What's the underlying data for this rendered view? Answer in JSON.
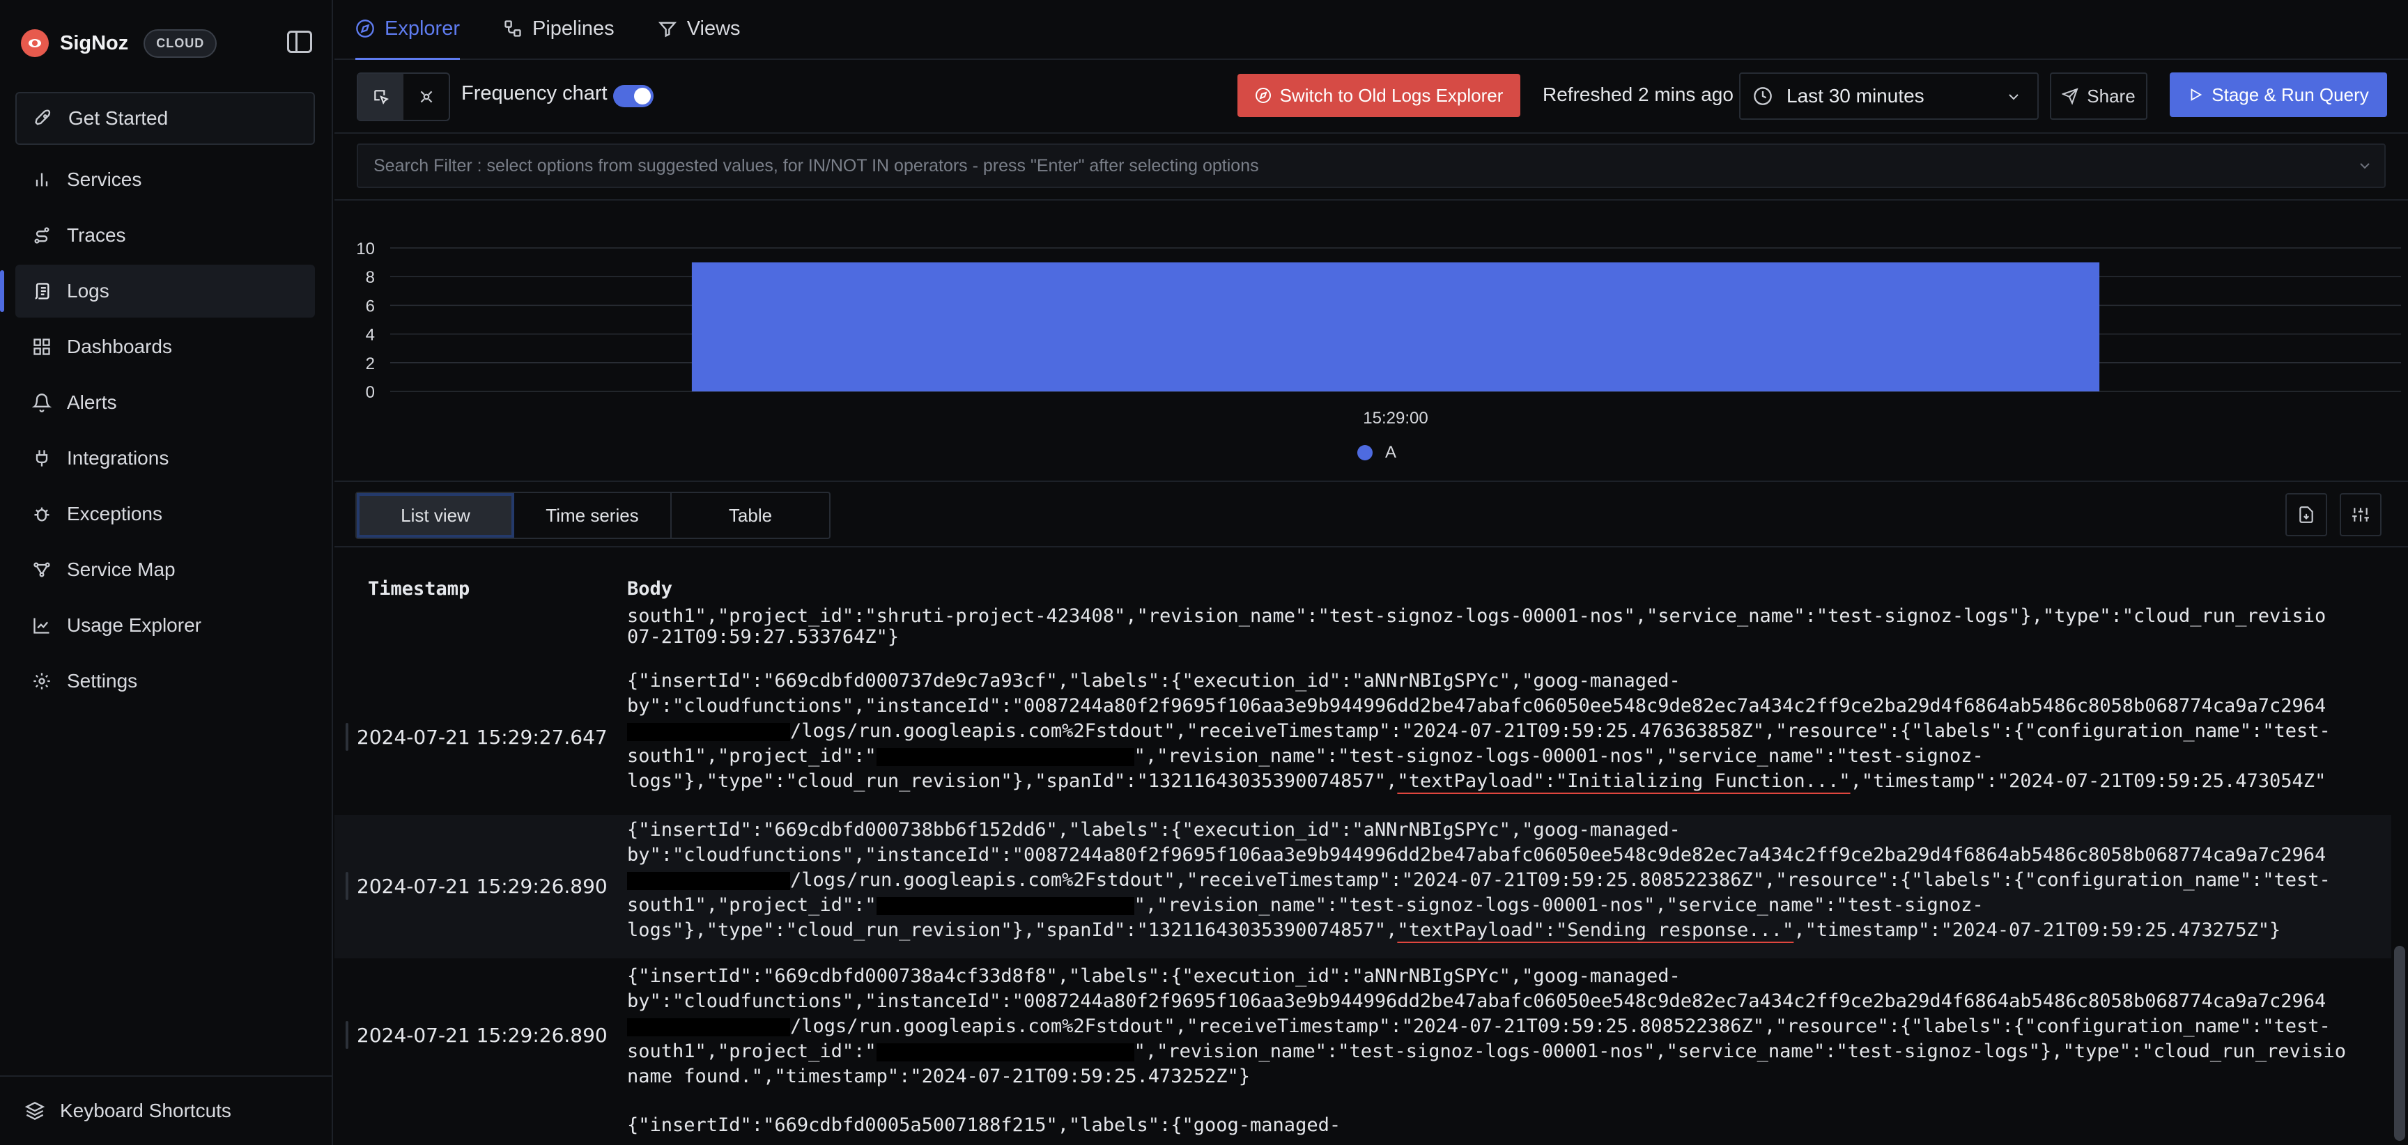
{
  "app": {
    "name": "SigNoz",
    "badge": "CLOUD"
  },
  "sidebar": {
    "items": [
      {
        "label": "Get Started",
        "icon": "rocket-icon"
      },
      {
        "label": "Services",
        "icon": "bar-chart-icon"
      },
      {
        "label": "Traces",
        "icon": "route-icon"
      },
      {
        "label": "Logs",
        "icon": "scroll-icon"
      },
      {
        "label": "Dashboards",
        "icon": "layout-grid-icon"
      },
      {
        "label": "Alerts",
        "icon": "bell-icon"
      },
      {
        "label": "Integrations",
        "icon": "plug-icon"
      },
      {
        "label": "Exceptions",
        "icon": "bug-icon"
      },
      {
        "label": "Service Map",
        "icon": "map-icon"
      },
      {
        "label": "Usage Explorer",
        "icon": "line-chart-icon"
      },
      {
        "label": "Settings",
        "icon": "gear-icon"
      }
    ],
    "active": "Logs",
    "shortcuts_label": "Keyboard Shortcuts"
  },
  "tabs": [
    {
      "label": "Explorer",
      "icon": "compass-icon",
      "active": true
    },
    {
      "label": "Pipelines",
      "icon": "workflow-icon",
      "active": false
    },
    {
      "label": "Views",
      "icon": "views-icon",
      "active": false
    }
  ],
  "toolbar": {
    "frequency_label": "Frequency chart",
    "frequency_on": true,
    "old_explorer_label": "Switch to Old Logs Explorer",
    "refreshed_label": "Refreshed 2 mins ago",
    "time_range": "Last 30 minutes",
    "share_label": "Share",
    "run_label": "Stage & Run Query"
  },
  "search": {
    "placeholder": "Search Filter : select options from suggested values, for IN/NOT IN operators - press \"Enter\" after selecting options"
  },
  "chart_data": {
    "type": "bar",
    "categories": [
      "15:29:00"
    ],
    "series": [
      {
        "name": "A",
        "values": [
          9
        ]
      }
    ],
    "ylim": [
      0,
      10
    ],
    "yticks": [
      0,
      2,
      4,
      6,
      8,
      10
    ],
    "grid": true,
    "legend": "bottom-center",
    "color": "#4e6be0"
  },
  "view_tabs": [
    {
      "label": "List view",
      "active": true
    },
    {
      "label": "Time series",
      "active": false
    },
    {
      "label": "Table",
      "active": false
    }
  ],
  "table": {
    "headers": {
      "timestamp": "Timestamp",
      "body": "Body"
    },
    "partial_top": [
      "south1\",\"project_id\":\"shruti-project-423408\",\"revision_name\":\"test-signoz-logs-00001-nos\",\"service_name\":\"test-signoz-logs\"},\"type\":\"cloud_run_revisio",
      "07-21T09:59:27.533764Z\"}"
    ],
    "rows": [
      {
        "timestamp": "2024-07-21 15:29:27.647",
        "l1": "{\"insertId\":\"669cdbfd000737de9c7a93cf\",\"labels\":{\"execution_id\":\"aNNrNBIgSPYc\",\"goog-managed-",
        "l2": "by\":\"cloudfunctions\",\"instanceId\":\"0087244a80f2f9695f106aa3e9b944996dd2be47abafc06050ee548c9de82ec7a434c2ff9ce2ba29d4f6864ab5486c8058b068774ca9a7c2964",
        "l3": "/logs/run.googleapis.com%2Fstdout\",\"receiveTimestamp\":\"2024-07-21T09:59:25.476363858Z\",\"resource\":{\"labels\":{\"configuration_name\":\"test-",
        "l4a": "south1\",\"project_id\":\"",
        "l4b": "\",\"revision_name\":\"test-signoz-logs-00001-nos\",\"service_name\":\"test-signoz-",
        "l5a": "logs\"},\"type\":\"cloud_run_revision\"},\"spanId\":\"13211643035390074857\",",
        "l5hl": "\"textPayload\":\"Initializing Function...\"",
        "l5b": ",\"timestamp\":\"2024-07-21T09:59:25.473054Z\""
      },
      {
        "timestamp": "2024-07-21 15:29:26.890",
        "l1": "{\"insertId\":\"669cdbfd000738bb6f152dd6\",\"labels\":{\"execution_id\":\"aNNrNBIgSPYc\",\"goog-managed-",
        "l2": "by\":\"cloudfunctions\",\"instanceId\":\"0087244a80f2f9695f106aa3e9b944996dd2be47abafc06050ee548c9de82ec7a434c2ff9ce2ba29d4f6864ab5486c8058b068774ca9a7c2964",
        "l3": "/logs/run.googleapis.com%2Fstdout\",\"receiveTimestamp\":\"2024-07-21T09:59:25.808522386Z\",\"resource\":{\"labels\":{\"configuration_name\":\"test-",
        "l4a": "south1\",\"project_id\":\"",
        "l4b": "\",\"revision_name\":\"test-signoz-logs-00001-nos\",\"service_name\":\"test-signoz-",
        "l5a": "logs\"},\"type\":\"cloud_run_revision\"},\"spanId\":\"13211643035390074857\",",
        "l5hl": "\"textPayload\":\"Sending response...\"",
        "l5b": ",\"timestamp\":\"2024-07-21T09:59:25.473275Z\"}"
      },
      {
        "timestamp": "2024-07-21 15:29:26.890",
        "l1": "{\"insertId\":\"669cdbfd000738a4cf33d8f8\",\"labels\":{\"execution_id\":\"aNNrNBIgSPYc\",\"goog-managed-",
        "l2": "by\":\"cloudfunctions\",\"instanceId\":\"0087244a80f2f9695f106aa3e9b944996dd2be47abafc06050ee548c9de82ec7a434c2ff9ce2ba29d4f6864ab5486c8058b068774ca9a7c2964",
        "l3": "/logs/run.googleapis.com%2Fstdout\",\"receiveTimestamp\":\"2024-07-21T09:59:25.808522386Z\",\"resource\":{\"labels\":{\"configuration_name\":\"test-",
        "l4a": "south1\",\"project_id\":\"",
        "l4b": "\",\"revision_name\":\"test-signoz-logs-00001-nos\",\"service_name\":\"test-signoz-logs\"},\"type\":\"cloud_run_revisio",
        "l5a": "name found.\",\"timestamp\":\"2024-07-21T09:59:25.473252Z\"}",
        "l5hl": "",
        "l5b": ""
      }
    ],
    "partial_bottom": "{\"insertId\":\"669cdbfd0005a5007188f215\",\"labels\":{\"goog-managed-"
  }
}
